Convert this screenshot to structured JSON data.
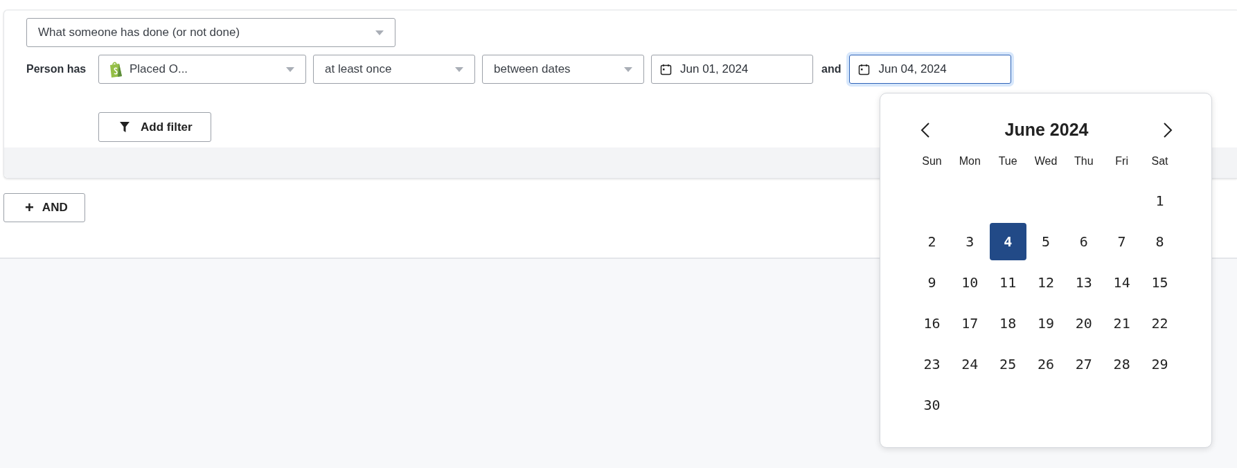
{
  "condition_select": {
    "value": "What someone has done (or not done)"
  },
  "filter_row": {
    "label": "Person has",
    "event_select": {
      "value": "Placed O..."
    },
    "frequency_select": {
      "value": "at least once"
    },
    "timeframe_select": {
      "value": "between dates"
    },
    "start_date": {
      "value": "Jun 01, 2024",
      "focused": false
    },
    "joiner": "and",
    "end_date": {
      "value": "Jun 04, 2024",
      "focused": true
    }
  },
  "add_filter_button": "Add filter",
  "and_button": {
    "icon": "+",
    "label": "AND"
  },
  "calendar": {
    "title": "June 2024",
    "weekdays": [
      "Sun",
      "Mon",
      "Tue",
      "Wed",
      "Thu",
      "Fri",
      "Sat"
    ],
    "weeks": [
      [
        {
          "day": "1",
          "selected": false
        }
      ],
      [
        {
          "day": "2",
          "selected": false
        },
        {
          "day": "3",
          "selected": false
        },
        {
          "day": "4",
          "selected": true
        },
        {
          "day": "5",
          "selected": false
        },
        {
          "day": "6",
          "selected": false
        },
        {
          "day": "7",
          "selected": false
        },
        {
          "day": "8",
          "selected": false
        }
      ],
      [
        {
          "day": "9",
          "selected": false
        },
        {
          "day": "10",
          "selected": false
        },
        {
          "day": "11",
          "selected": false
        },
        {
          "day": "12",
          "selected": false
        },
        {
          "day": "13",
          "selected": false
        },
        {
          "day": "14",
          "selected": false
        },
        {
          "day": "15",
          "selected": false
        }
      ],
      [
        {
          "day": "16",
          "selected": false
        },
        {
          "day": "17",
          "selected": false
        },
        {
          "day": "18",
          "selected": false
        },
        {
          "day": "19",
          "selected": false
        },
        {
          "day": "20",
          "selected": false
        },
        {
          "day": "21",
          "selected": false
        },
        {
          "day": "22",
          "selected": false
        }
      ],
      [
        {
          "day": "23",
          "selected": false
        },
        {
          "day": "24",
          "selected": false
        },
        {
          "day": "25",
          "selected": false
        },
        {
          "day": "26",
          "selected": false
        },
        {
          "day": "27",
          "selected": false
        },
        {
          "day": "28",
          "selected": false
        },
        {
          "day": "29",
          "selected": false
        }
      ],
      [
        {
          "day": "30",
          "selected": false
        }
      ]
    ]
  }
}
